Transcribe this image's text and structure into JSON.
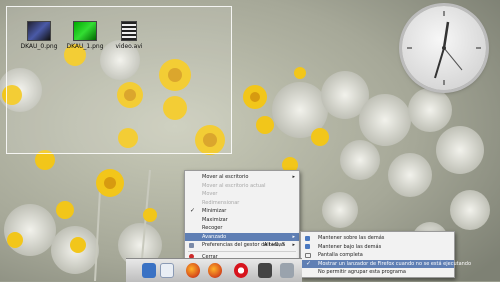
{
  "desktop": {
    "icons": [
      {
        "label": "DKAU_0.png",
        "icon": "image-file-icon"
      },
      {
        "label": "DKAU_1.png",
        "icon": "image-file-icon"
      },
      {
        "label": "video.avi",
        "icon": "video-file-icon"
      }
    ]
  },
  "context_menu": {
    "items": [
      {
        "label": "Mover al escritorio",
        "state": "normal"
      },
      {
        "label": "Mover al escritorio actual",
        "state": "disabled"
      },
      {
        "label": "Mover",
        "state": "disabled"
      },
      {
        "label": "Redimensionar",
        "state": "disabled"
      },
      {
        "label": "Minimizar",
        "state": "checked"
      },
      {
        "label": "Maximizar",
        "state": "normal"
      },
      {
        "label": "Recoger",
        "state": "normal"
      },
      {
        "label": "Avanzado",
        "state": "active"
      },
      {
        "label": "Preferencias del gestor de tareas",
        "shortcut": "Alt+D, S",
        "state": "normal",
        "icon": "settings-icon"
      },
      {
        "label": "Cerrar",
        "state": "normal",
        "icon": "close-icon"
      }
    ]
  },
  "submenu": {
    "items": [
      {
        "label": "Mantener sobre las demás",
        "icon": "up-icon"
      },
      {
        "label": "Mantener bajo las demás",
        "icon": "down-icon"
      },
      {
        "label": "Pantalla completa",
        "icon": "fullscreen-icon"
      },
      {
        "label": "Mostrar un lanzador de Firefox cuando no se está ejecutando",
        "state": "checked"
      },
      {
        "label": "No permitir agrupar esta programa"
      }
    ]
  },
  "taskbar": {
    "apps": [
      "file-manager-icon",
      "document-icon",
      "firefox-icon",
      "firefox-icon",
      "opera-icon",
      "terminal-icon",
      "system-settings-icon"
    ]
  },
  "colors": {
    "menu_bg": "#f2f2f2",
    "menu_highlight": "#5f7fb4",
    "close_icon": "#cc2a2a"
  }
}
